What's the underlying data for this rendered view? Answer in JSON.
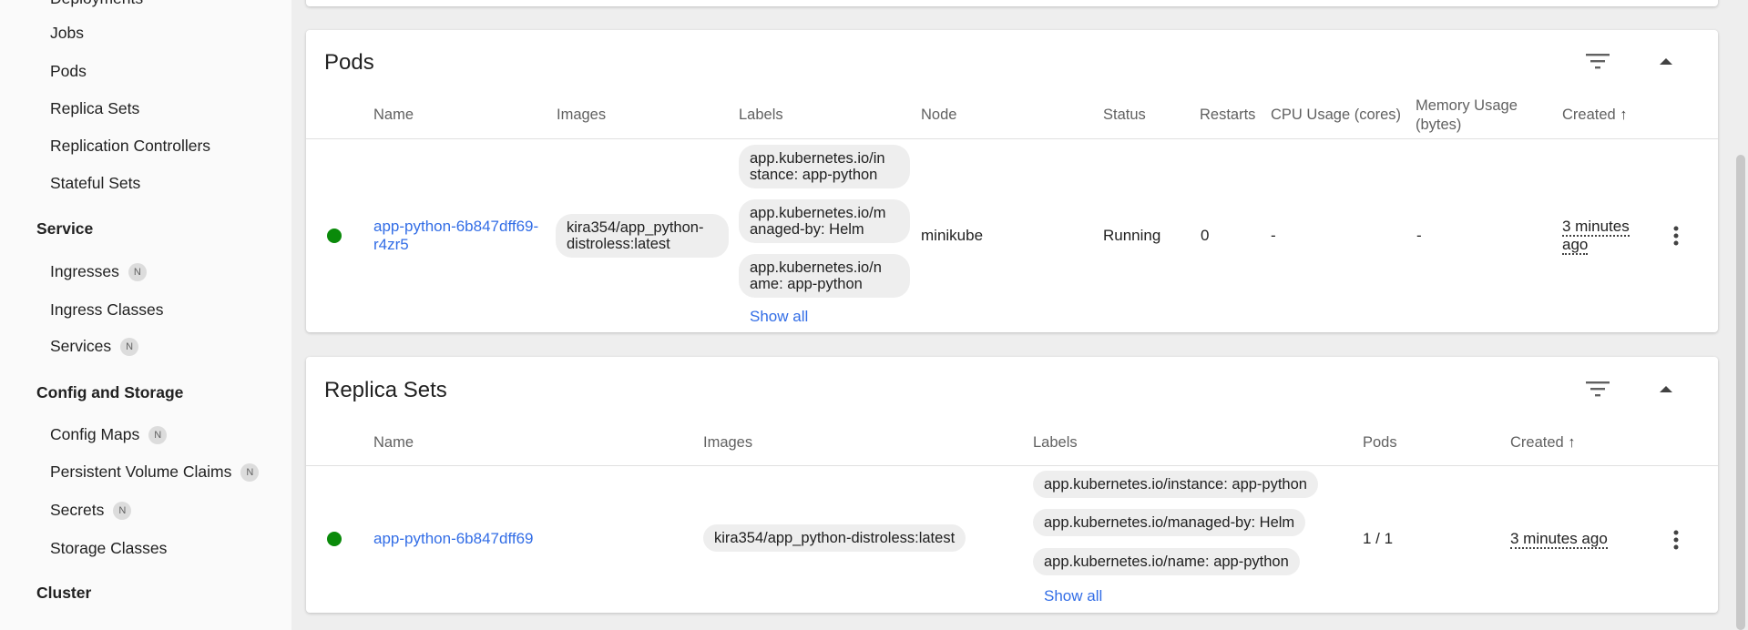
{
  "sidebar": {
    "items_workloads": [
      {
        "label": "Deployments"
      },
      {
        "label": "Jobs"
      },
      {
        "label": "Pods"
      },
      {
        "label": "Replica Sets"
      },
      {
        "label": "Replication Controllers"
      },
      {
        "label": "Stateful Sets"
      }
    ],
    "section_service": "Service",
    "items_service": [
      {
        "label": "Ingresses",
        "badge": "N"
      },
      {
        "label": "Ingress Classes"
      },
      {
        "label": "Services",
        "badge": "N"
      }
    ],
    "section_config": "Config and Storage",
    "items_config": [
      {
        "label": "Config Maps",
        "badge": "N"
      },
      {
        "label": "Persistent Volume Claims",
        "badge": "N"
      },
      {
        "label": "Secrets",
        "badge": "N"
      },
      {
        "label": "Storage Classes"
      }
    ],
    "section_cluster": "Cluster"
  },
  "pods": {
    "title": "Pods",
    "columns": [
      "Name",
      "Images",
      "Labels",
      "Node",
      "Status",
      "Restarts",
      "CPU Usage (cores)",
      "Memory Usage (bytes)",
      "Created"
    ],
    "sort_arrow": "↑",
    "row": {
      "name_line1": "app-python-6b847dff69-",
      "name_line2": "r4zr5",
      "image_line1": "kira354/app_python-",
      "image_line2": "distroless:latest",
      "labels": [
        {
          "line1": "app.kubernetes.io/in",
          "line2": "stance: app-python"
        },
        {
          "line1": "app.kubernetes.io/m",
          "line2": "anaged-by: Helm"
        },
        {
          "line1": "app.kubernetes.io/n",
          "line2": "ame: app-python"
        }
      ],
      "show_all": "Show all",
      "node": "minikube",
      "status": "Running",
      "restarts": "0",
      "cpu": "-",
      "memory": "-",
      "created_line1": "3 minutes",
      "created_line2": "ago"
    }
  },
  "replica_sets": {
    "title": "Replica Sets",
    "columns": [
      "Name",
      "Images",
      "Labels",
      "Pods",
      "Created"
    ],
    "sort_arrow": "↑",
    "row": {
      "name": "app-python-6b847dff69",
      "image": "kira354/app_python-distroless:latest",
      "labels": [
        "app.kubernetes.io/instance: app-python",
        "app.kubernetes.io/managed-by: Helm",
        "app.kubernetes.io/name: app-python"
      ],
      "show_all": "Show all",
      "pods": "1 / 1",
      "created": "3 minutes ago"
    }
  },
  "icons": {
    "filter": "filter-icon",
    "collapse": "chevron-up-icon",
    "more": "more-vert-icon",
    "sort": "arrow-up-icon"
  },
  "colors": {
    "link": "#326de6",
    "running": "#0a8a0a",
    "chip_bg": "#eeeeee"
  }
}
